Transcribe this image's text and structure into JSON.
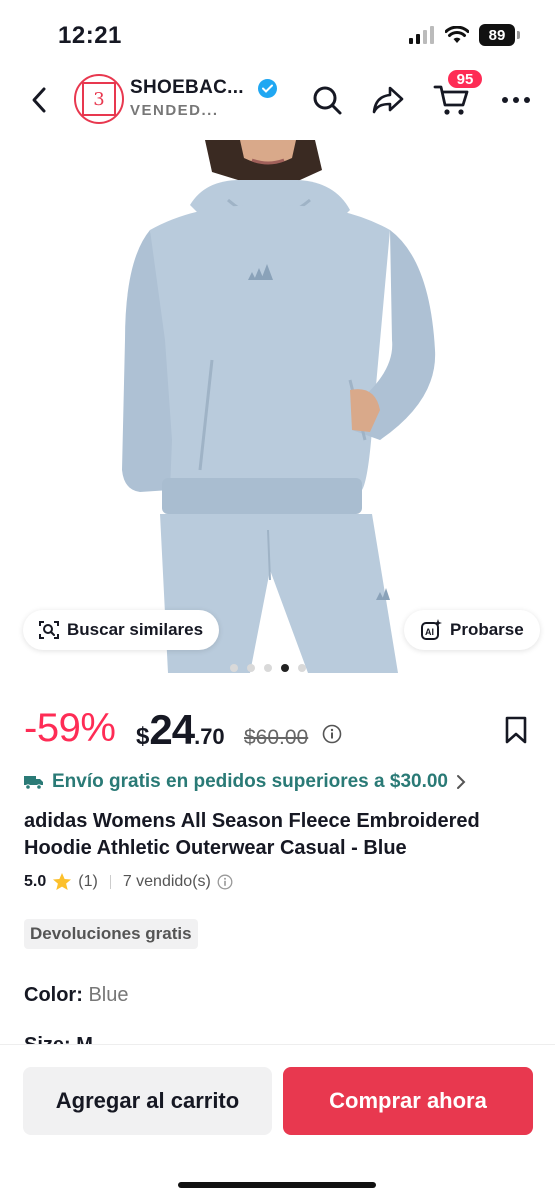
{
  "status": {
    "time": "12:21",
    "battery": "89"
  },
  "header": {
    "shop_name": "SHOEBAC...",
    "shop_subtitle": "VENDED...",
    "logo_text": "3",
    "cart_count": "95"
  },
  "gallery": {
    "similar_label": "Buscar similares",
    "try_on_label": "Probarse",
    "dots_total": 5,
    "dots_active_index": 3
  },
  "price": {
    "discount": "-59%",
    "currency": "$",
    "integer": "24",
    "decimal": ".70",
    "original": "$60.00"
  },
  "shipping": {
    "text": "Envío gratis en pedidos superiores a $30.00"
  },
  "product": {
    "title": "adidas Womens All Season Fleece Embroidered Hoodie Athletic Outerwear Casual - Blue",
    "rating": "5.0",
    "review_count": "(1)",
    "sold": "7 vendido(s)",
    "returns_badge": "Devoluciones gratis",
    "color_label": "Color:",
    "color_value": "Blue",
    "size_peek": "Size: M"
  },
  "actions": {
    "add_to_cart": "Agregar al carrito",
    "buy_now": "Comprar ahora"
  },
  "colors": {
    "accent": "#fe2c55",
    "buy_button": "#e8384f",
    "shipping_teal": "#2a7a76",
    "hoodie": "#b9cbdc"
  }
}
